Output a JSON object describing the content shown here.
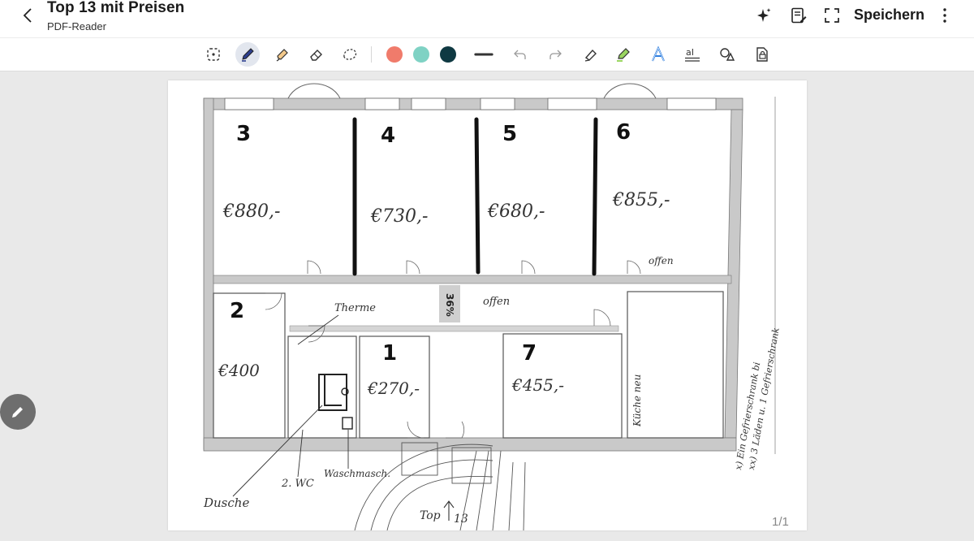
{
  "header": {
    "title": "Top 13 mit Preisen",
    "subtitle": "PDF-Reader",
    "save_label": "Speichern"
  },
  "toolbar": {
    "tools": [
      "lasso-select-icon",
      "pen-icon",
      "highlighter-icon",
      "eraser-icon",
      "shape-lasso-icon",
      "undo-icon",
      "redo-icon",
      "pencil-eraser-icon",
      "marker-icon",
      "text-style-icon",
      "text-box-icon",
      "shapes-icon",
      "lock-page-icon"
    ],
    "colors": [
      "#f07b6b",
      "#7fd2c4",
      "#0f3942"
    ]
  },
  "document": {
    "rooms": [
      {
        "number": "3",
        "price": "€880,-"
      },
      {
        "number": "4",
        "price": "€730,-"
      },
      {
        "number": "5",
        "price": "€680,-"
      },
      {
        "number": "6",
        "price": "€855,-"
      },
      {
        "number": "2",
        "price": "€400"
      },
      {
        "number": "1",
        "price": "€270,-"
      },
      {
        "number": "7",
        "price": "€455,-"
      }
    ],
    "notes": {
      "therme": "Therme",
      "offen1": "offen",
      "offen2": "offen",
      "dusche": "Dusche",
      "wc": "2. WC",
      "waschm": "Waschmasch.",
      "kueche": "Küche neu",
      "top": "Top",
      "top_num": "13",
      "percent": "36%",
      "side1": "x) Ein Gefrierschrank bi",
      "side2": "xx) 3 Läden u. 1 Gefrierschrank"
    }
  },
  "pager": "1/1"
}
